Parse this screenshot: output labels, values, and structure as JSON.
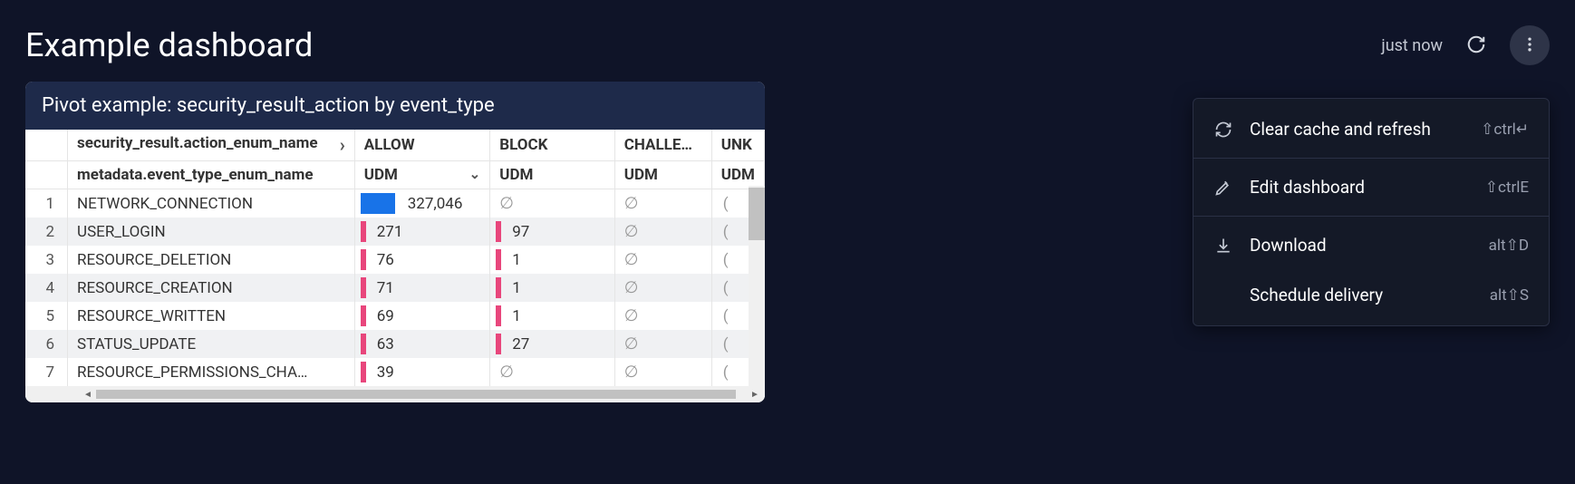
{
  "header": {
    "title": "Example dashboard",
    "last_refresh": "just now"
  },
  "panel": {
    "title": "Pivot example: security_result_action by event_type",
    "dim_col_header": "security_result.action_enum_name",
    "dim_row_header": "metadata.event_type_enum_name",
    "value_header": "UDM",
    "columns": [
      "ALLOW",
      "BLOCK",
      "CHALLE…",
      "UNK"
    ],
    "rows": [
      {
        "n": 1,
        "label": "NETWORK_CONNECTION",
        "allow": "327,046",
        "allow_bar": "blue",
        "block": "∅",
        "block_bar": "none",
        "chal": "∅"
      },
      {
        "n": 2,
        "label": "USER_LOGIN",
        "allow": "271",
        "allow_bar": "pink",
        "block": "97",
        "block_bar": "pink",
        "chal": "∅"
      },
      {
        "n": 3,
        "label": "RESOURCE_DELETION",
        "allow": "76",
        "allow_bar": "pink",
        "block": "1",
        "block_bar": "pink",
        "chal": "∅"
      },
      {
        "n": 4,
        "label": "RESOURCE_CREATION",
        "allow": "71",
        "allow_bar": "pink",
        "block": "1",
        "block_bar": "pink",
        "chal": "∅"
      },
      {
        "n": 5,
        "label": "RESOURCE_WRITTEN",
        "allow": "69",
        "allow_bar": "pink",
        "block": "1",
        "block_bar": "pink",
        "chal": "∅"
      },
      {
        "n": 6,
        "label": "STATUS_UPDATE",
        "allow": "63",
        "allow_bar": "pink",
        "block": "27",
        "block_bar": "pink",
        "chal": "∅"
      },
      {
        "n": 7,
        "label": "RESOURCE_PERMISSIONS_CHA…",
        "allow": "39",
        "allow_bar": "pink",
        "block": "∅",
        "block_bar": "none",
        "chal": "∅"
      }
    ]
  },
  "menu": {
    "items": [
      {
        "icon": "refresh",
        "label": "Clear cache and refresh",
        "shortcut": "⇧ctrl↵"
      },
      {
        "icon": "pencil",
        "label": "Edit dashboard",
        "shortcut": "⇧ctrlE"
      },
      {
        "icon": "download",
        "label": "Download",
        "shortcut": "alt⇧D"
      },
      {
        "icon": "",
        "label": "Schedule delivery",
        "shortcut": "alt⇧S"
      }
    ]
  },
  "chart_data": {
    "type": "table",
    "title": "Pivot example: security_result_action by event_type",
    "column_dimension": "security_result.action_enum_name",
    "row_dimension": "metadata.event_type_enum_name",
    "measure": "UDM",
    "columns": [
      "ALLOW",
      "BLOCK",
      "CHALLENGE",
      "UNKNOWN"
    ],
    "rows": [
      {
        "event_type": "NETWORK_CONNECTION",
        "ALLOW": 327046,
        "BLOCK": null,
        "CHALLENGE": null
      },
      {
        "event_type": "USER_LOGIN",
        "ALLOW": 271,
        "BLOCK": 97,
        "CHALLENGE": null
      },
      {
        "event_type": "RESOURCE_DELETION",
        "ALLOW": 76,
        "BLOCK": 1,
        "CHALLENGE": null
      },
      {
        "event_type": "RESOURCE_CREATION",
        "ALLOW": 71,
        "BLOCK": 1,
        "CHALLENGE": null
      },
      {
        "event_type": "RESOURCE_WRITTEN",
        "ALLOW": 69,
        "BLOCK": 1,
        "CHALLENGE": null
      },
      {
        "event_type": "STATUS_UPDATE",
        "ALLOW": 63,
        "BLOCK": 27,
        "CHALLENGE": null
      },
      {
        "event_type": "RESOURCE_PERMISSIONS_CHANGE",
        "ALLOW": 39,
        "BLOCK": null,
        "CHALLENGE": null
      }
    ]
  }
}
